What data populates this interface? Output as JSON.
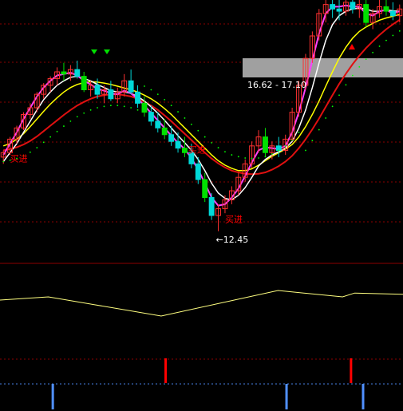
{
  "chart_data": {
    "type": "candlestick",
    "colors": {
      "background": "#000000",
      "grid": "#8b0000",
      "candle_up": "#ff3030",
      "candle_down": "#00d8d8",
      "candle_green": "#00e000",
      "ma_white": "#ffffff",
      "ma_yellow": "#ffff00",
      "ma_magenta": "#ff40ff",
      "ma_red": "#e01010",
      "dots": "#00ff00",
      "signal_red": "#ff0000",
      "signal_blue": "#5090ff",
      "osc_line": "#ffff80",
      "band": "#a0a0a0"
    },
    "price_range": [
      12.0,
      17.6
    ],
    "candles": [
      [
        14.1,
        14.25,
        13.95,
        14.2
      ],
      [
        14.2,
        14.55,
        14.15,
        14.5
      ],
      [
        14.5,
        14.8,
        14.4,
        14.75
      ],
      [
        14.75,
        15.1,
        14.7,
        15.05
      ],
      [
        15.05,
        15.3,
        14.95,
        15.2
      ],
      [
        15.2,
        15.55,
        15.1,
        15.5
      ],
      [
        15.5,
        15.75,
        15.4,
        15.7
      ],
      [
        15.7,
        15.9,
        15.55,
        15.85
      ],
      [
        15.85,
        16.1,
        15.7,
        16.0
      ],
      [
        16.0,
        16.2,
        15.8,
        15.95
      ],
      [
        15.95,
        16.15,
        15.8,
        16.05
      ],
      [
        16.05,
        16.25,
        15.85,
        15.9
      ],
      [
        15.9,
        16.0,
        15.55,
        15.6
      ],
      [
        15.6,
        15.8,
        15.45,
        15.7
      ],
      [
        15.7,
        15.85,
        15.4,
        15.5
      ],
      [
        15.5,
        15.7,
        15.3,
        15.6
      ],
      [
        15.6,
        15.8,
        15.35,
        15.4
      ],
      [
        15.4,
        15.65,
        15.3,
        15.55
      ],
      [
        15.55,
        15.95,
        15.45,
        15.8
      ],
      [
        15.8,
        16.05,
        15.5,
        15.55
      ],
      [
        15.55,
        15.7,
        15.2,
        15.3
      ],
      [
        15.3,
        15.45,
        15.0,
        15.1
      ],
      [
        15.1,
        15.25,
        14.8,
        14.9
      ],
      [
        14.9,
        15.1,
        14.65,
        14.75
      ],
      [
        14.75,
        14.95,
        14.5,
        14.6
      ],
      [
        14.6,
        14.8,
        14.35,
        14.45
      ],
      [
        14.45,
        14.65,
        14.2,
        14.3
      ],
      [
        14.3,
        14.55,
        14.1,
        14.2
      ],
      [
        14.2,
        14.4,
        13.85,
        13.95
      ],
      [
        13.95,
        14.1,
        13.5,
        13.6
      ],
      [
        13.6,
        13.75,
        13.1,
        13.2
      ],
      [
        13.2,
        13.3,
        12.7,
        12.8
      ],
      [
        12.8,
        13.05,
        12.45,
        12.95
      ],
      [
        12.95,
        13.25,
        12.85,
        13.15
      ],
      [
        13.15,
        13.45,
        13.05,
        13.35
      ],
      [
        13.35,
        13.75,
        13.25,
        13.65
      ],
      [
        13.65,
        14.05,
        13.55,
        13.95
      ],
      [
        13.95,
        14.45,
        13.85,
        14.35
      ],
      [
        14.35,
        14.7,
        14.2,
        14.55
      ],
      [
        14.55,
        14.75,
        14.1,
        14.2
      ],
      [
        14.2,
        14.45,
        14.05,
        14.35
      ],
      [
        14.35,
        14.55,
        14.1,
        14.25
      ],
      [
        14.25,
        14.6,
        14.15,
        14.5
      ],
      [
        14.5,
        15.2,
        14.45,
        15.1
      ],
      [
        15.1,
        15.8,
        15.0,
        15.7
      ],
      [
        15.7,
        16.4,
        15.6,
        16.3
      ],
      [
        16.3,
        16.9,
        16.2,
        16.8
      ],
      [
        16.8,
        17.4,
        16.7,
        17.3
      ],
      [
        17.3,
        17.6,
        17.1,
        17.5
      ],
      [
        17.5,
        17.6,
        17.2,
        17.4
      ],
      [
        17.4,
        17.6,
        17.15,
        17.35
      ],
      [
        17.35,
        17.6,
        17.25,
        17.55
      ],
      [
        17.55,
        17.6,
        17.3,
        17.4
      ],
      [
        17.4,
        17.6,
        17.2,
        17.5
      ],
      [
        17.5,
        17.6,
        17.0,
        17.1
      ],
      [
        17.1,
        17.4,
        16.95,
        17.3
      ],
      [
        17.3,
        17.6,
        17.2,
        17.45
      ],
      [
        17.45,
        17.6,
        17.25,
        17.35
      ],
      [
        17.35,
        17.55,
        17.15,
        17.25
      ],
      [
        17.25,
        17.5,
        17.1,
        17.4
      ]
    ],
    "ma_fast": [
      14.15,
      14.4,
      14.65,
      14.95,
      15.2,
      15.45,
      15.65,
      15.8,
      15.92,
      15.95,
      15.98,
      15.92,
      15.8,
      15.72,
      15.62,
      15.58,
      15.52,
      15.5,
      15.58,
      15.52,
      15.4,
      15.25,
      15.08,
      14.92,
      14.75,
      14.58,
      14.42,
      14.28,
      14.08,
      13.82,
      13.52,
      13.2,
      13.02,
      13.05,
      13.2,
      13.4,
      13.68,
      13.98,
      14.25,
      14.32,
      14.3,
      14.28,
      14.35,
      14.65,
      15.1,
      15.65,
      16.25,
      16.85,
      17.3,
      17.45,
      17.45,
      17.48,
      17.45,
      17.45,
      17.3,
      17.25,
      17.35,
      17.38,
      17.3,
      17.35
    ],
    "ma_mid": [
      14.0,
      14.2,
      14.4,
      14.65,
      14.9,
      15.15,
      15.38,
      15.55,
      15.7,
      15.8,
      15.88,
      15.9,
      15.85,
      15.8,
      15.72,
      15.65,
      15.58,
      15.55,
      15.55,
      15.52,
      15.45,
      15.35,
      15.22,
      15.08,
      14.92,
      14.75,
      14.58,
      14.42,
      14.25,
      14.05,
      13.8,
      13.52,
      13.3,
      13.18,
      13.15,
      13.25,
      13.42,
      13.65,
      13.9,
      14.05,
      14.15,
      14.22,
      14.3,
      14.45,
      14.75,
      15.15,
      15.65,
      16.2,
      16.7,
      17.05,
      17.25,
      17.35,
      17.4,
      17.42,
      17.4,
      17.35,
      17.35,
      17.38,
      17.36,
      17.35
    ],
    "ma_slow": [
      14.35,
      14.4,
      14.5,
      14.62,
      14.78,
      14.95,
      15.12,
      15.28,
      15.42,
      15.55,
      15.65,
      15.72,
      15.76,
      15.78,
      15.77,
      15.75,
      15.72,
      15.68,
      15.64,
      15.6,
      15.55,
      15.48,
      15.4,
      15.3,
      15.18,
      15.05,
      14.9,
      14.75,
      14.6,
      14.45,
      14.3,
      14.15,
      14.02,
      13.92,
      13.85,
      13.8,
      13.8,
      13.84,
      13.92,
      14.02,
      14.12,
      14.2,
      14.28,
      14.38,
      14.55,
      14.78,
      15.05,
      15.35,
      15.68,
      16.0,
      16.3,
      16.55,
      16.75,
      16.9,
      17.0,
      17.08,
      17.15,
      17.2,
      17.24,
      17.28
    ],
    "ma_long": [
      14.25,
      14.28,
      14.32,
      14.38,
      14.46,
      14.56,
      14.68,
      14.8,
      14.92,
      15.04,
      15.15,
      15.25,
      15.33,
      15.4,
      15.45,
      15.48,
      15.5,
      15.5,
      15.48,
      15.45,
      15.4,
      15.33,
      15.25,
      15.15,
      15.03,
      14.9,
      14.76,
      14.62,
      14.48,
      14.34,
      14.2,
      14.07,
      13.96,
      13.87,
      13.8,
      13.76,
      13.73,
      13.72,
      13.73,
      13.76,
      13.82,
      13.9,
      14.0,
      14.13,
      14.3,
      14.5,
      14.72,
      14.96,
      15.22,
      15.48,
      15.73,
      15.96,
      16.17,
      16.36,
      16.53,
      16.68,
      16.82,
      16.95,
      17.06,
      17.16
    ],
    "annotations": {
      "buy_label": "买进",
      "low_label": "12.45",
      "range_label": "16.62 - 17.10"
    },
    "oscillator": {
      "points": [
        [
          0,
          0.55
        ],
        [
          12,
          0.6
        ],
        [
          40,
          0.3
        ],
        [
          69,
          0.7
        ],
        [
          85,
          0.6
        ],
        [
          88,
          0.66
        ],
        [
          100,
          0.64
        ]
      ]
    },
    "signals": {
      "red_bars": [
        41,
        87
      ],
      "blue_bars": [
        13,
        71,
        90
      ]
    }
  }
}
